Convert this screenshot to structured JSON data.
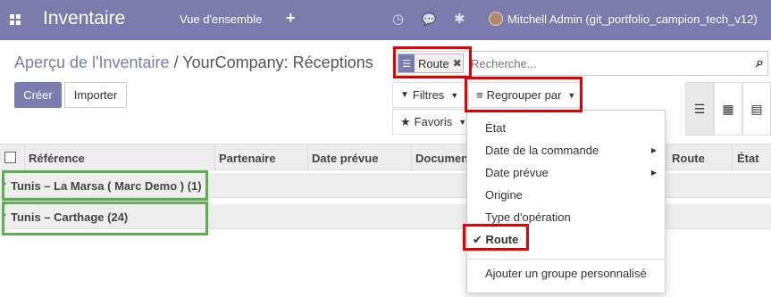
{
  "nav": {
    "app_title": "Inventaire",
    "overview_label": "Vue d'ensemble",
    "plus_label": "+",
    "clock_icon": "◷",
    "chat_icon": "💬",
    "bug_icon": "✱",
    "user_name": "Mitchell Admin (git_portfolio_campion_tech_v12)"
  },
  "breadcrumb": {
    "parent": "Aperçu de l'Inventaire",
    "separator": "/",
    "current": "YourCompany: Réceptions"
  },
  "buttons": {
    "create": "Créer",
    "import": "Importer"
  },
  "search": {
    "facet_label": "Route",
    "facet_close": "✖",
    "placeholder": "Recherche...",
    "magnifier": "🔍"
  },
  "toolbar": {
    "filters": "Filtres",
    "group_by": "Regrouper par",
    "favorites": "Favoris"
  },
  "table": {
    "columns": [
      "Référence",
      "Partenaire",
      "Date prévue",
      "Documen",
      "Route",
      "État"
    ],
    "groups": [
      {
        "label": "Tunis – La Marsa ( Marc Demo ) (1)"
      },
      {
        "label": "Tunis – Carthage (24)"
      }
    ]
  },
  "groupby_menu": {
    "items": [
      {
        "label": "État"
      },
      {
        "label": "Date de la commande"
      },
      {
        "label": "Date prévue"
      },
      {
        "label": "Origine"
      },
      {
        "label": "Type d'opération"
      },
      {
        "label": "Route",
        "checked": true
      }
    ],
    "custom_group": "Ajouter un groupe personnalisé"
  },
  "colors": {
    "brand": "#7c7bad",
    "highlight_red": "#e00000",
    "highlight_green": "#5caf4f"
  }
}
